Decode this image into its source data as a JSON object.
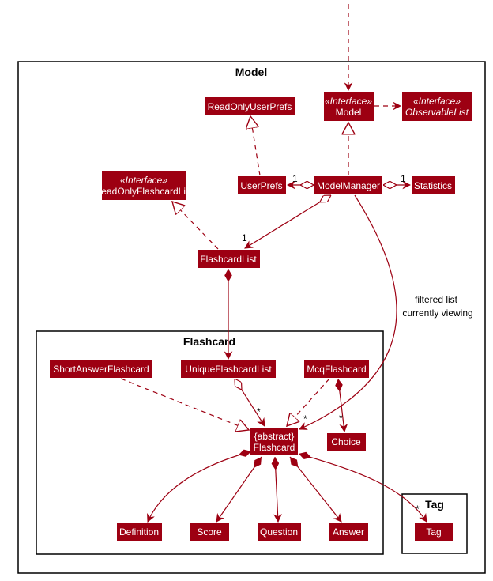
{
  "colors": {
    "class_fill": "#9d0012",
    "class_text": "#ffffff",
    "package_border": "#000000"
  },
  "packages": {
    "model": "Model",
    "flashcard": "Flashcard",
    "tag": "Tag"
  },
  "stereotype": "«Interface»",
  "classes": {
    "read_only_user_prefs": "ReadOnlyUserPrefs",
    "model": "Model",
    "observable_list": "ObservableList",
    "read_only_flashcard_list": "ReadOnlyFlashcardList",
    "user_prefs": "UserPrefs",
    "model_manager": "ModelManager",
    "statistics": "Statistics",
    "flashcard_list": "FlashcardList",
    "short_answer_flashcard": "ShortAnswerFlashcard",
    "unique_flashcard_list": "UniqueFlashcardList",
    "mcq_flashcard": "McqFlashcard",
    "flashcard_abstract_label": "{abstract}",
    "flashcard": "Flashcard",
    "choice": "Choice",
    "definition": "Definition",
    "score": "Score",
    "question": "Question",
    "answer": "Answer",
    "tag": "Tag"
  },
  "multiplicities": {
    "one": "1",
    "many": "*"
  },
  "note": {
    "line1": "filtered list",
    "line2": "currently viewing"
  }
}
